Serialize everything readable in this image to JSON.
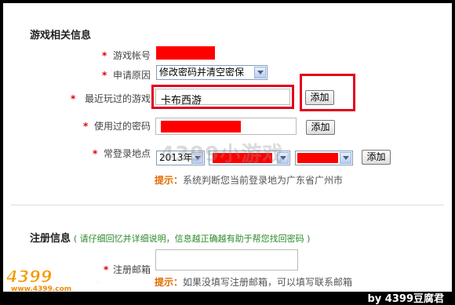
{
  "section_game": {
    "title": "游戏相关信息",
    "fields": {
      "account_label": "游戏帐号",
      "reason_label": "申请原因",
      "reason_value": "修改密码并清空密保",
      "recent_game_label": "最近玩过的游戏",
      "recent_game_value": "卡布西游",
      "password_label": "使用过的密码",
      "location_label": "常登录地点",
      "year_value": "2013年"
    },
    "buttons": {
      "add": "添加"
    },
    "tip": {
      "label": "提示：",
      "text": "系统判断您当前登录地为广东省广州市"
    }
  },
  "section_register": {
    "title": "注册信息",
    "note": "( 请仔细回忆并详细说明，信息越正确越有助于帮您找回密码 )",
    "email_label": "注册邮箱",
    "tip": {
      "label": "提示：",
      "text": "如果没填写注册邮箱，可以填写联系邮箱"
    }
  },
  "watermark": {
    "logo": "4399小游戏",
    "url": "www.4399.com",
    "center": "4399小游戏"
  },
  "credit": "by 4399豆腐君",
  "colors": {
    "required": "#dd0000",
    "highlight_frame": "#e0001e",
    "tip_label": "#e06c00",
    "note": "#2a8a2a"
  },
  "required_mark": "*"
}
